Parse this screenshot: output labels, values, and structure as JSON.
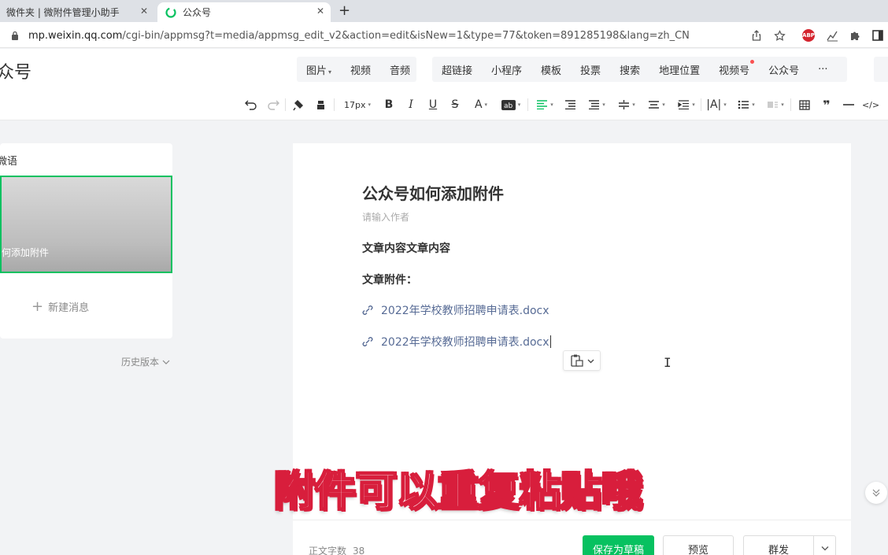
{
  "browser": {
    "tabs": [
      {
        "title": "微件夹 | 微附件管理小助手",
        "active": false
      },
      {
        "title": "公众号",
        "active": true
      }
    ],
    "close_glyph": "✕",
    "new_tab_glyph": "+",
    "url_host": "mp.weixin.qq.com",
    "url_path": "/cgi-bin/appmsg?t=media/appmsg_edit_v2&action=edit&isNew=1&type=77&token=891285198&lang=zh_CN",
    "abp_label": "ABP"
  },
  "header": {
    "title": "众号",
    "insert_group_1": [
      {
        "label": "图片",
        "caret": "▾"
      },
      {
        "label": "视频"
      },
      {
        "label": "音频"
      }
    ],
    "insert_group_2": [
      {
        "label": "超链接"
      },
      {
        "label": "小程序"
      },
      {
        "label": "模板"
      },
      {
        "label": "投票"
      },
      {
        "label": "搜索"
      },
      {
        "label": "地理位置"
      },
      {
        "label": "视频号",
        "dot": true
      },
      {
        "label": "公众号"
      },
      {
        "label": "···"
      }
    ]
  },
  "toolbar": {
    "font_size": "17px",
    "dd": "▾"
  },
  "left": {
    "account": "微语",
    "cover_title": "何添加附件",
    "new_message": "新建消息",
    "history": "历史版本"
  },
  "article": {
    "title": "公众号如何添加附件",
    "author_placeholder": "请输入作者",
    "p1": "文章内容文章内容",
    "p2": "文章附件：",
    "attachments": [
      "2022年学校教师招聘申请表.docx",
      "2022年学校教师招聘申请表.docx"
    ]
  },
  "subtitle": "附件可以重复粘贴哦",
  "footer": {
    "word_count_label": "正文字数",
    "word_count": "38",
    "save_draft": "保存为草稿",
    "preview": "预览",
    "publish": "群发"
  },
  "colors": {
    "accent": "#07c160",
    "link": "#576b95",
    "subtitle_outline": "#d81e3c"
  }
}
